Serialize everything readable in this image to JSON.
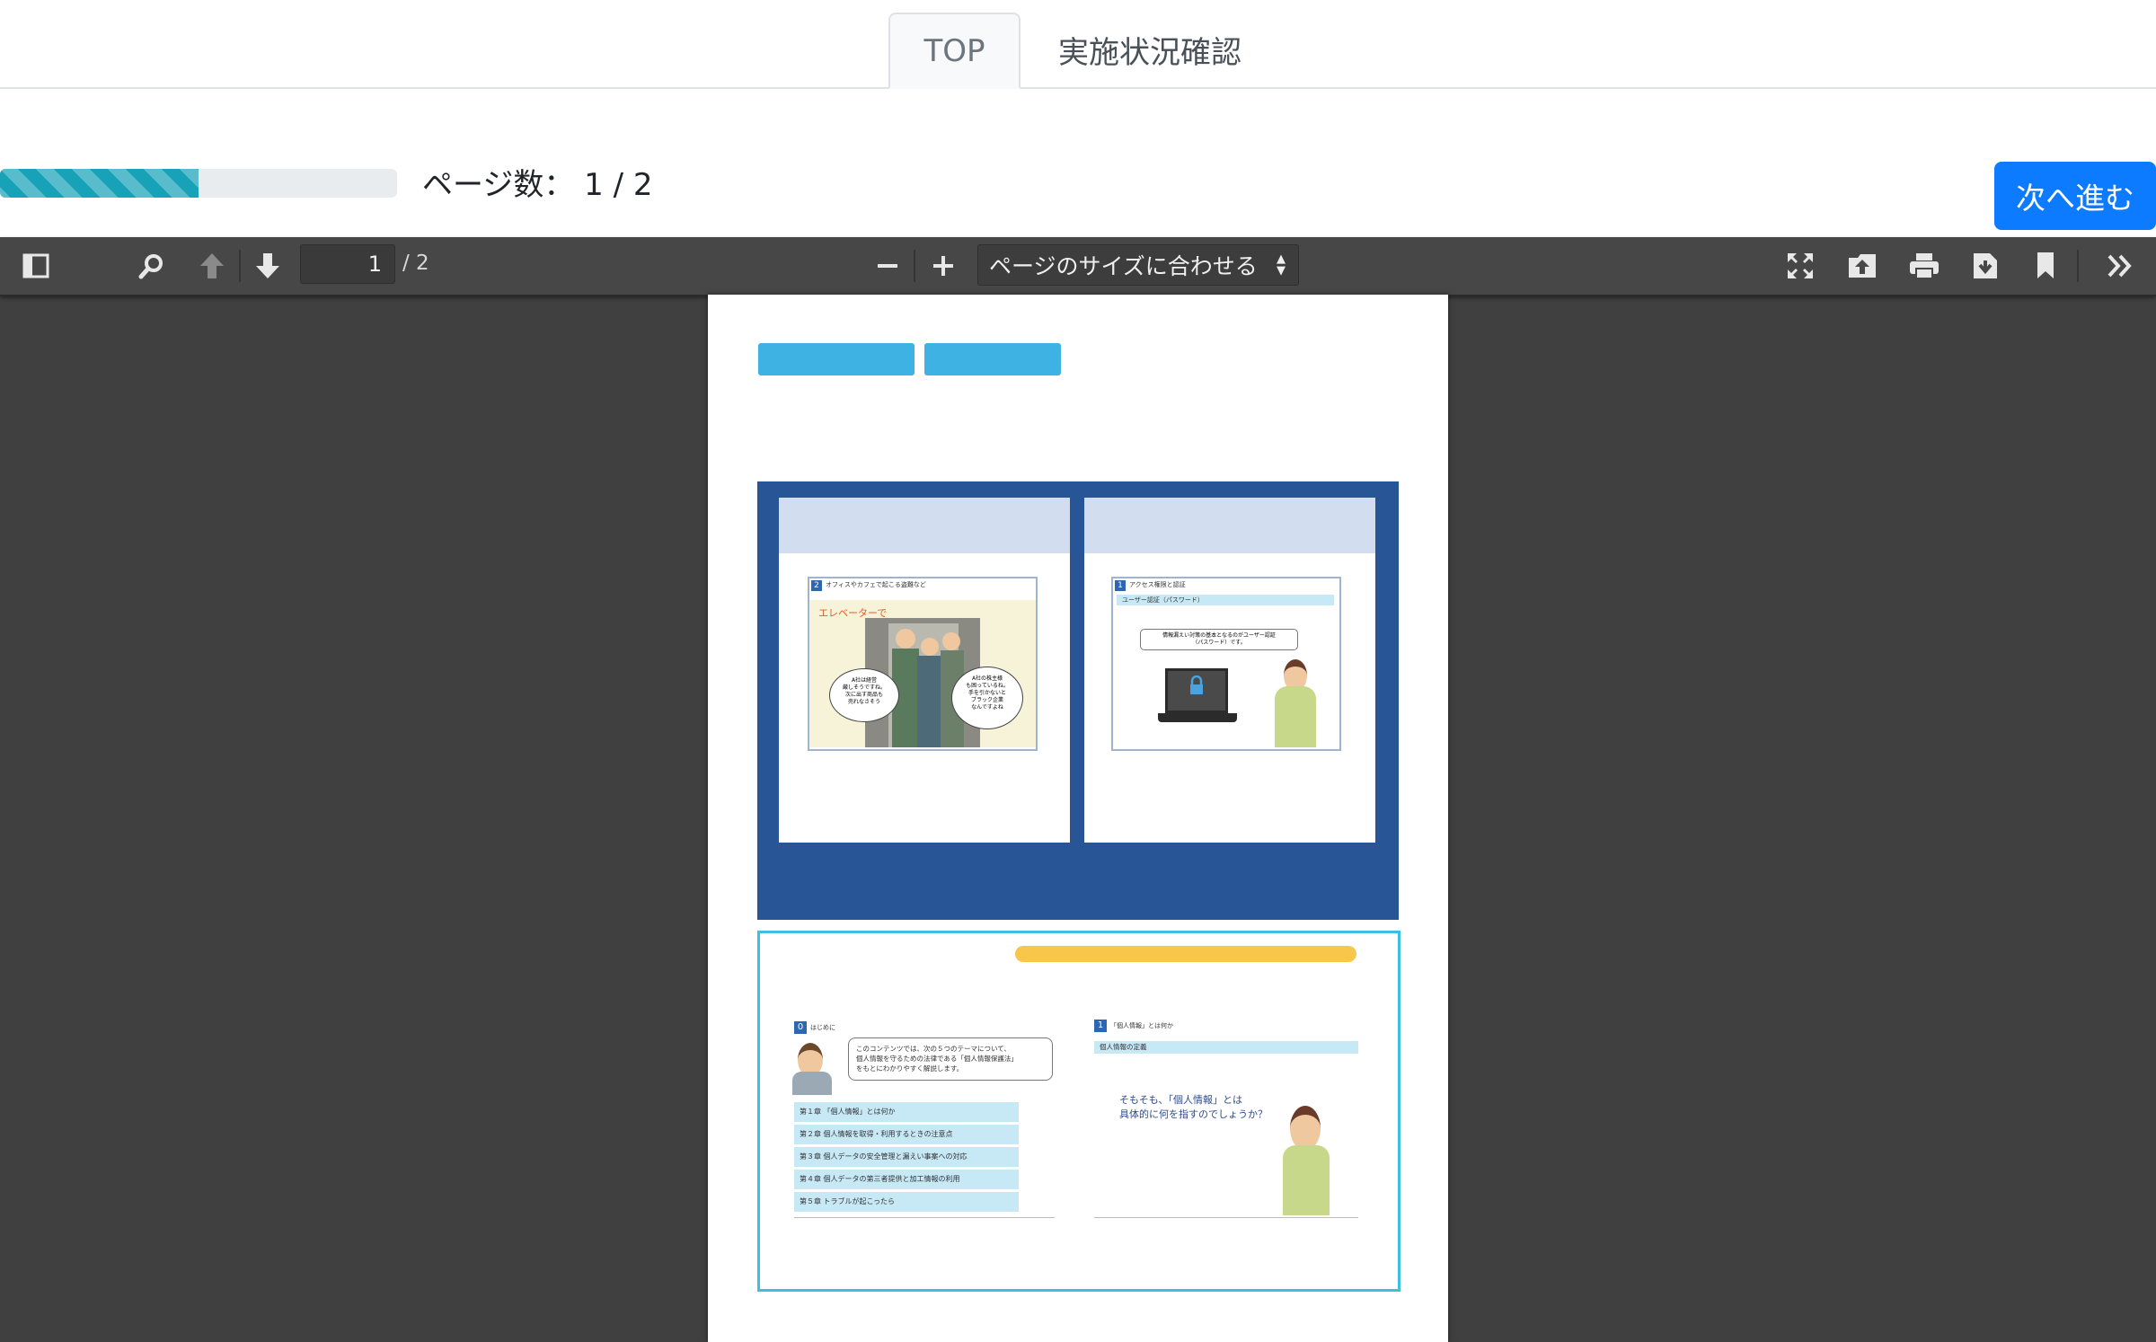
{
  "tabs": [
    {
      "label": "TOP",
      "active": true
    },
    {
      "label": "実施状況確認",
      "active": false
    }
  ],
  "progress": {
    "fraction": 0.5,
    "label": "ページ数： 1 / 2",
    "color": "#17a2b8"
  },
  "next_button": {
    "label": "次へ進む",
    "color": "#0d7bff"
  },
  "pdf_viewer": {
    "toolbar": {
      "current_page": "1",
      "total_pages": "/ 2",
      "zoom_option": "ページのサイズに合わせる"
    },
    "document": {
      "panel1": {
        "header_num": "2",
        "header_text": "オフィスやカフェで起こる盗難など",
        "caption": "エレベーターで",
        "bubble_left": "A社は経営\n厳しそうですね。\n次に出す商品も\n売れなさそう",
        "bubble_right": "A社の株主様\nも困っているね。\n手を引かないと\nブラック企業\nなんですよね"
      },
      "panel2": {
        "header_num": "1",
        "header_text": "アクセス権限と認証",
        "subtitle": "ユーザー認証（パスワード）",
        "bubble": "情報漏えい対策の基本となるのがユーザー認証\n（パスワード）です。"
      },
      "panel3": {
        "header_num": "0",
        "header_text": "はじめに",
        "bubble": "このコンテンツでは、次の５つのテーマについて、\n個人情報を守るための法律である「個人情報保護法」\nをもとにわかりやすく解説します。",
        "chapters": [
          "第１章 「個人情報」とは何か",
          "第２章 個人情報を取得・利用するときの注意点",
          "第３章 個人データの安全管理と漏えい事案への対応",
          "第４章 個人データの第三者提供と加工情報の利用",
          "第５章 トラブルが起こったら"
        ]
      },
      "panel4": {
        "header_num": "1",
        "header_text": "「個人情報」とは何か",
        "subtitle": "個人情報の定義",
        "question": "そもそも、「個人情報」とは\n具体的に何を指すのでしょうか？"
      }
    }
  }
}
